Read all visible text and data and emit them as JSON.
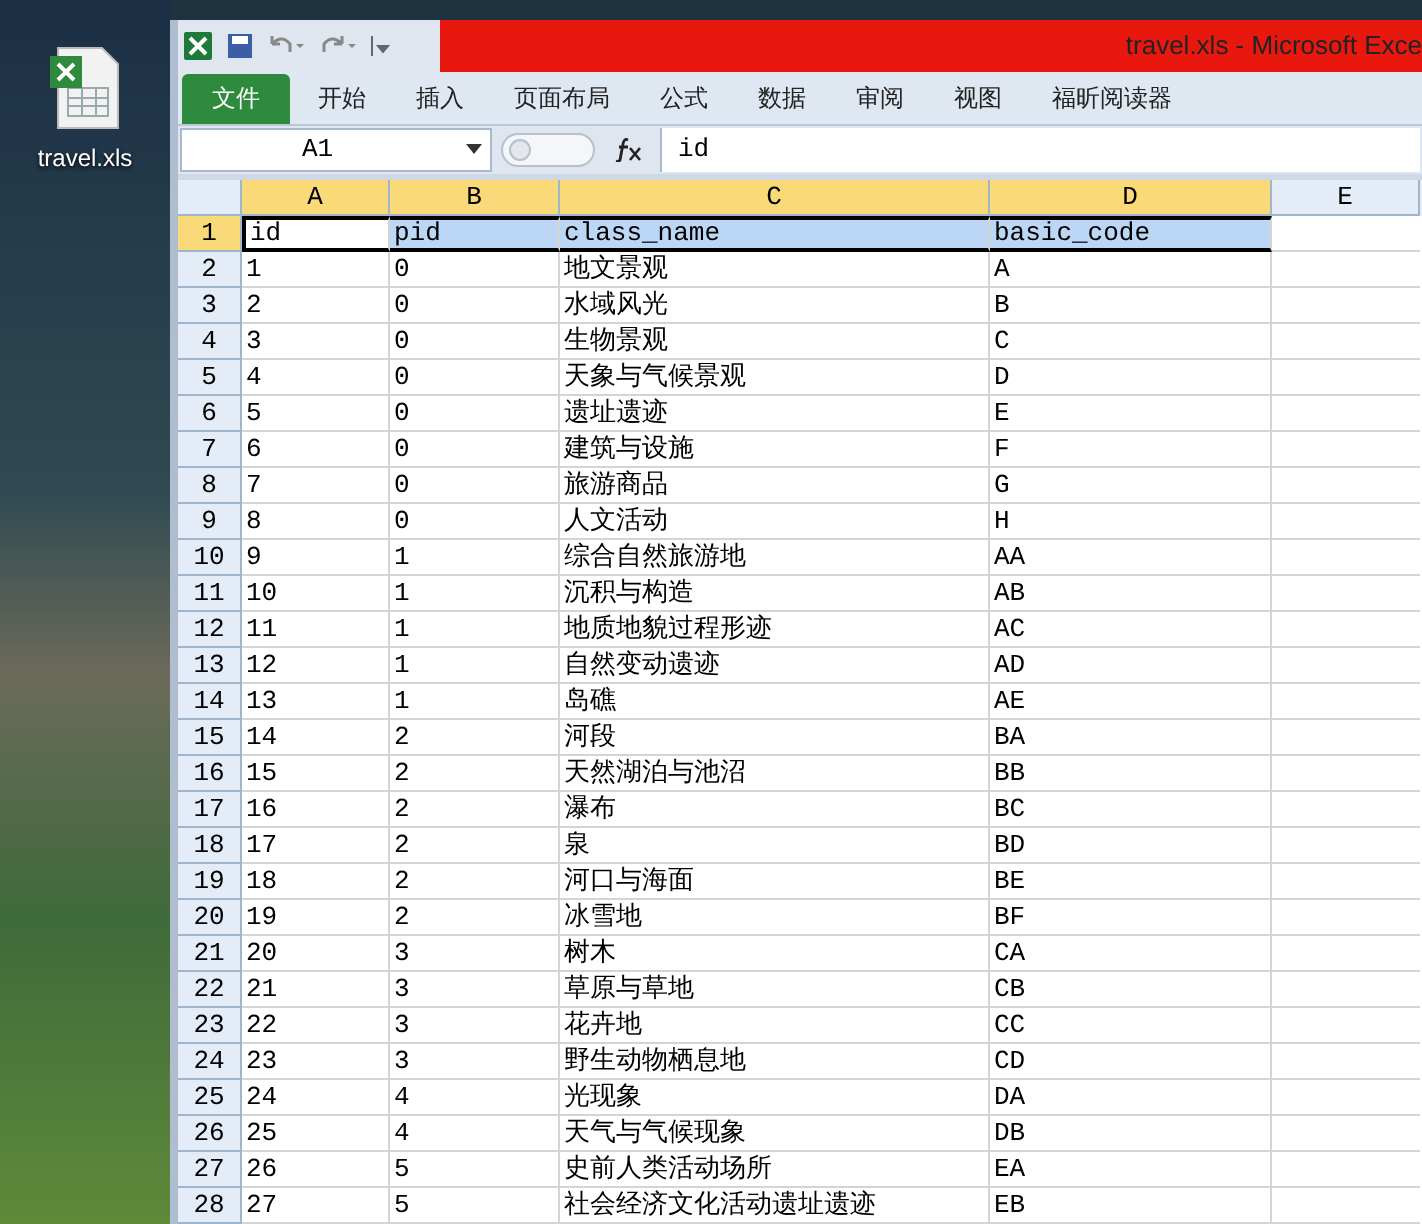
{
  "desktop": {
    "icon_label": "travel.xls"
  },
  "window": {
    "title": "travel.xls  -  Microsoft Exce"
  },
  "ribbon_tabs": [
    {
      "label": "文件",
      "kind": "file"
    },
    {
      "label": "开始",
      "kind": "tab"
    },
    {
      "label": "插入",
      "kind": "tab"
    },
    {
      "label": "页面布局",
      "kind": "tab"
    },
    {
      "label": "公式",
      "kind": "tab"
    },
    {
      "label": "数据",
      "kind": "tab"
    },
    {
      "label": "审阅",
      "kind": "tab"
    },
    {
      "label": "视图",
      "kind": "tab"
    },
    {
      "label": "福昕阅读器",
      "kind": "tab"
    }
  ],
  "formula_bar": {
    "name_box": "A1",
    "value": "id"
  },
  "columns": [
    {
      "label": "A",
      "selected": true
    },
    {
      "label": "B",
      "selected": true
    },
    {
      "label": "C",
      "selected": true
    },
    {
      "label": "D",
      "selected": true
    },
    {
      "label": "E",
      "selected": false
    }
  ],
  "rows": [
    {
      "number": "1",
      "selected": true,
      "cells": [
        "id",
        "pid",
        "class_name",
        "basic_code"
      ]
    },
    {
      "number": "2",
      "selected": false,
      "cells": [
        "1",
        "0",
        "地文景观",
        "A"
      ]
    },
    {
      "number": "3",
      "selected": false,
      "cells": [
        "2",
        "0",
        "水域风光",
        "B"
      ]
    },
    {
      "number": "4",
      "selected": false,
      "cells": [
        "3",
        "0",
        "生物景观",
        "C"
      ]
    },
    {
      "number": "5",
      "selected": false,
      "cells": [
        "4",
        "0",
        "天象与气候景观",
        "D"
      ]
    },
    {
      "number": "6",
      "selected": false,
      "cells": [
        "5",
        "0",
        "遗址遗迹",
        "E"
      ]
    },
    {
      "number": "7",
      "selected": false,
      "cells": [
        "6",
        "0",
        "建筑与设施",
        "F"
      ]
    },
    {
      "number": "8",
      "selected": false,
      "cells": [
        "7",
        "0",
        "旅游商品",
        "G"
      ]
    },
    {
      "number": "9",
      "selected": false,
      "cells": [
        "8",
        "0",
        "人文活动",
        "H"
      ]
    },
    {
      "number": "10",
      "selected": false,
      "cells": [
        "9",
        "1",
        "综合自然旅游地",
        "AA"
      ]
    },
    {
      "number": "11",
      "selected": false,
      "cells": [
        "10",
        "1",
        "沉积与构造",
        "AB"
      ]
    },
    {
      "number": "12",
      "selected": false,
      "cells": [
        "11",
        "1",
        "地质地貌过程形迹",
        "AC"
      ]
    },
    {
      "number": "13",
      "selected": false,
      "cells": [
        "12",
        "1",
        "自然变动遗迹",
        "AD"
      ]
    },
    {
      "number": "14",
      "selected": false,
      "cells": [
        "13",
        "1",
        "岛礁",
        "AE"
      ]
    },
    {
      "number": "15",
      "selected": false,
      "cells": [
        "14",
        "2",
        "河段",
        "BA"
      ]
    },
    {
      "number": "16",
      "selected": false,
      "cells": [
        "15",
        "2",
        "天然湖泊与池沼",
        "BB"
      ]
    },
    {
      "number": "17",
      "selected": false,
      "cells": [
        "16",
        "2",
        "瀑布",
        "BC"
      ]
    },
    {
      "number": "18",
      "selected": false,
      "cells": [
        "17",
        "2",
        "泉",
        "BD"
      ]
    },
    {
      "number": "19",
      "selected": false,
      "cells": [
        "18",
        "2",
        "河口与海面",
        "BE"
      ]
    },
    {
      "number": "20",
      "selected": false,
      "cells": [
        "19",
        "2",
        "冰雪地",
        "BF"
      ]
    },
    {
      "number": "21",
      "selected": false,
      "cells": [
        "20",
        "3",
        "树木",
        "CA"
      ]
    },
    {
      "number": "22",
      "selected": false,
      "cells": [
        "21",
        "3",
        "草原与草地",
        "CB"
      ]
    },
    {
      "number": "23",
      "selected": false,
      "cells": [
        "22",
        "3",
        "花卉地",
        "CC"
      ]
    },
    {
      "number": "24",
      "selected": false,
      "cells": [
        "23",
        "3",
        "野生动物栖息地",
        "CD"
      ]
    },
    {
      "number": "25",
      "selected": false,
      "cells": [
        "24",
        "4",
        "光现象",
        "DA"
      ]
    },
    {
      "number": "26",
      "selected": false,
      "cells": [
        "25",
        "4",
        "天气与气候现象",
        "DB"
      ]
    },
    {
      "number": "27",
      "selected": false,
      "cells": [
        "26",
        "5",
        "史前人类活动场所",
        "EA"
      ]
    },
    {
      "number": "28",
      "selected": false,
      "cells": [
        "27",
        "5",
        "社会经济文化活动遗址遗迹",
        "EB"
      ]
    }
  ]
}
